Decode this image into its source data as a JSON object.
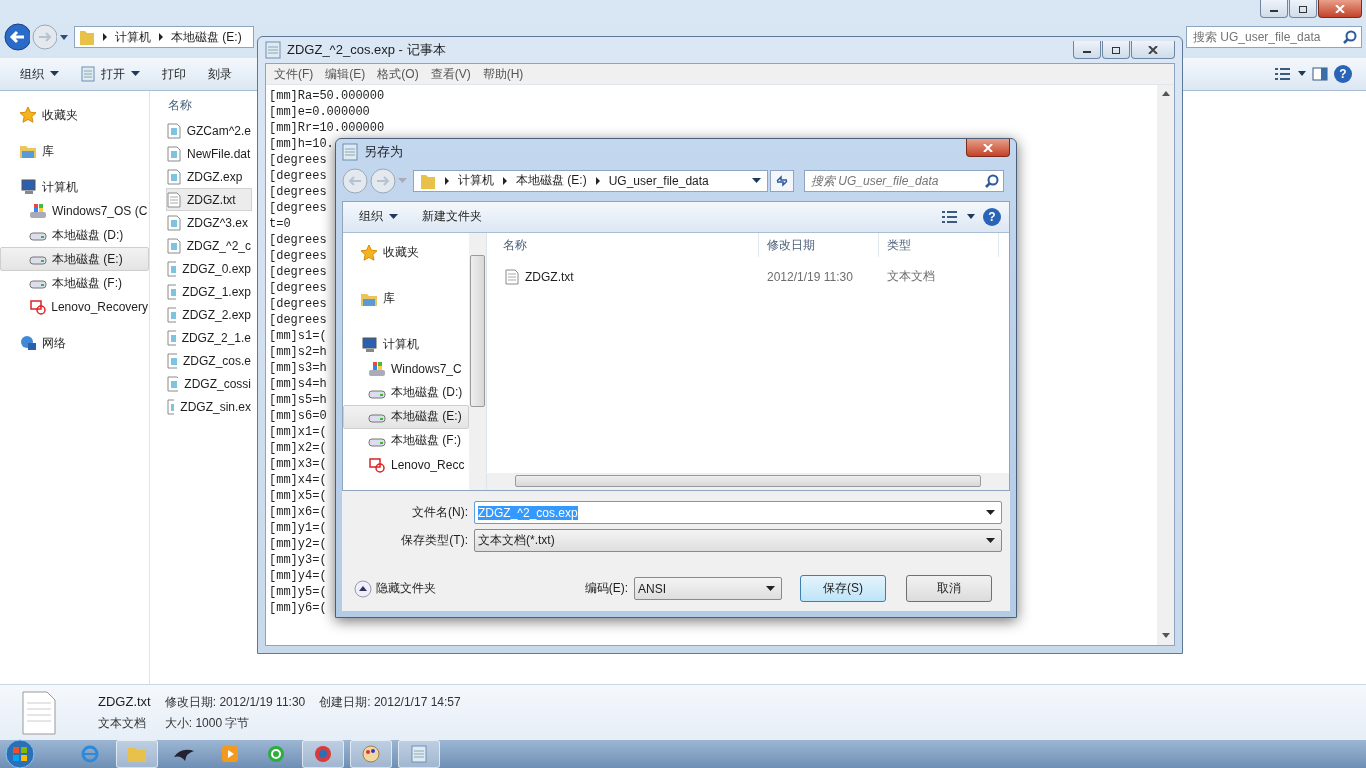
{
  "explorer": {
    "address": [
      "计算机",
      "本地磁盘 (E:)"
    ],
    "search": {
      "placeholder": "搜索 UG_user_file_data"
    },
    "toolbar": [
      {
        "label": "组织",
        "menu": true,
        "kind": "plain"
      },
      {
        "label": "打开",
        "menu": true,
        "kind": "open"
      },
      {
        "label": "打印",
        "menu": false,
        "kind": "plain"
      },
      {
        "label": "刻录",
        "menu": false,
        "kind": "plain"
      }
    ],
    "sidebar": [
      {
        "label": "收藏夹",
        "kind": "favorites",
        "selected": false
      },
      {
        "label": "库",
        "kind": "library",
        "selected": false
      },
      {
        "label": "计算机",
        "kind": "computer",
        "selected": false,
        "children": [
          {
            "label": "Windows7_OS (C",
            "kind": "os-drive",
            "selected": false
          },
          {
            "label": "本地磁盘 (D:)",
            "kind": "drive",
            "selected": false
          },
          {
            "label": "本地磁盘 (E:)",
            "kind": "drive",
            "selected": true
          },
          {
            "label": "本地磁盘 (F:)",
            "kind": "drive",
            "selected": false
          },
          {
            "label": "Lenovo_Recovery",
            "kind": "recovery",
            "selected": false
          }
        ]
      },
      {
        "label": "网络",
        "kind": "network",
        "selected": false
      }
    ],
    "help": "?",
    "column": "名称",
    "files": [
      {
        "name": "GZCam^2.e",
        "kind": "document",
        "selected": false
      },
      {
        "name": "NewFile.dat",
        "kind": "document",
        "selected": false
      },
      {
        "name": "ZDGZ.exp",
        "kind": "document",
        "selected": false
      },
      {
        "name": "ZDGZ.txt",
        "kind": "text",
        "selected": true
      },
      {
        "name": "ZDGZ^3.ex",
        "kind": "document",
        "selected": false
      },
      {
        "name": "ZDGZ_^2_c",
        "kind": "document",
        "selected": false
      },
      {
        "name": "ZDGZ_0.exp",
        "kind": "document",
        "selected": false
      },
      {
        "name": "ZDGZ_1.exp",
        "kind": "document",
        "selected": false
      },
      {
        "name": "ZDGZ_2.exp",
        "kind": "document",
        "selected": false
      },
      {
        "name": "ZDGZ_2_1.e",
        "kind": "document",
        "selected": false
      },
      {
        "name": "ZDGZ_cos.e",
        "kind": "document",
        "selected": false
      },
      {
        "name": "ZDGZ_cossi",
        "kind": "document",
        "selected": false
      },
      {
        "name": "ZDGZ_sin.ex",
        "kind": "document",
        "selected": false
      }
    ],
    "details": {
      "name": "ZDGZ.txt",
      "modified": "修改日期: 2012/1/19 11:30",
      "created": "创建日期: 2012/1/17 14:57",
      "type": "文本文档",
      "size": "大小: 1000 字节"
    }
  },
  "notepad": {
    "title": "ZDGZ_^2_cos.exp - 记事本",
    "menu": [
      "文件(F)",
      "编辑(E)",
      "格式(O)",
      "查看(V)",
      "帮助(H)"
    ],
    "lines": [
      "[mm]Ra=50.000000",
      "[mm]e=0.000000",
      "[mm]Rr=10.000000",
      "[mm]h=10.",
      "[degrees",
      "[degrees",
      "[degrees",
      "[degrees",
      "t=0",
      "[degrees",
      "[degrees",
      "[degrees",
      "[degrees",
      "[degrees",
      "[degrees",
      "[mm]s1=(",
      "[mm]s2=h",
      "[mm]s3=h",
      "[mm]s4=h",
      "[mm]s5=h",
      "[mm]s6=0",
      "[mm]x1=(",
      "[mm]x2=(",
      "[mm]x3=(",
      "[mm]x4=(",
      "[mm]x5=(",
      "[mm]x6=(",
      "[mm]y1=(",
      "[mm]y2=(",
      "[mm]y3=(",
      "[mm]y4=(",
      "[mm]y5=(",
      "[mm]y6=("
    ]
  },
  "dialog": {
    "title": "另存为",
    "path": [
      "计算机",
      "本地磁盘 (E:)",
      "UG_user_file_data"
    ],
    "search": {
      "placeholder": "搜索 UG_user_file_data"
    },
    "toolbar": [
      {
        "label": "组织",
        "menu": true
      },
      {
        "label": "新建文件夹",
        "menu": false
      }
    ],
    "help": "?",
    "sidebar": [
      {
        "label": "收藏夹",
        "kind": "favorites",
        "selected": false
      },
      {
        "label": "库",
        "kind": "library",
        "selected": false
      },
      {
        "label": "计算机",
        "kind": "computer",
        "selected": false,
        "children": [
          {
            "label": "Windows7_C",
            "kind": "os-drive",
            "selected": false
          },
          {
            "label": "本地磁盘 (D:)",
            "kind": "drive",
            "selected": false
          },
          {
            "label": "本地磁盘 (E:)",
            "kind": "drive",
            "selected": true
          },
          {
            "label": "本地磁盘 (F:)",
            "kind": "drive",
            "selected": false
          },
          {
            "label": "Lenovo_Recc",
            "kind": "recovery",
            "selected": false
          }
        ]
      }
    ],
    "columns": [
      "名称",
      "修改日期",
      "类型"
    ],
    "files": [
      {
        "name": "ZDGZ.txt",
        "date": "2012/1/19 11:30",
        "type": "文本文档"
      }
    ],
    "filename": {
      "label": "文件名(N):",
      "value": "ZDGZ_^2_cos.exp",
      "value_selected": true
    },
    "filetype": {
      "label": "保存类型(T):",
      "value": "文本文档(*.txt)"
    },
    "hide_folders": "隐藏文件夹",
    "encoding": {
      "label": "编码(E):",
      "value": "ANSI"
    },
    "buttons": [
      {
        "label": "保存(S)",
        "kind": "primary"
      },
      {
        "label": "取消",
        "kind": "normal"
      }
    ]
  }
}
